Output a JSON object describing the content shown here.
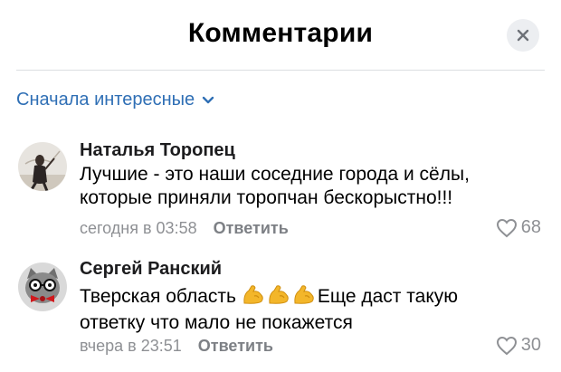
{
  "header": {
    "title": "Комментарии",
    "close_icon": "close-icon"
  },
  "sort": {
    "label": "Сначала интересные",
    "icon": "chevron-down-icon"
  },
  "colors": {
    "accent": "#2f6fb5",
    "meta_text": "#8e9094",
    "close_bg": "#eceef1",
    "divider": "#dcdee2"
  },
  "comments": [
    {
      "author": "Наталья Торопец",
      "text_lines": [
        "Лучшие - это наши соседние города и сёлы,",
        "которые приняли торопчан бескорыстно!!!"
      ],
      "time": "сегодня в 03:58",
      "reply_label": "Ответить",
      "likes": "68"
    },
    {
      "author": "Сергей Ранский",
      "text_line1_before": "Тверская область ",
      "emojis": [
        "flexed-biceps-icon",
        "flexed-biceps-icon",
        "flexed-biceps-icon"
      ],
      "text_line1_after": "Еще даст такую",
      "text_line2": "ответку что мало не покажется",
      "time": "вчера в 23:51",
      "reply_label": "Ответить",
      "likes": "30"
    }
  ]
}
